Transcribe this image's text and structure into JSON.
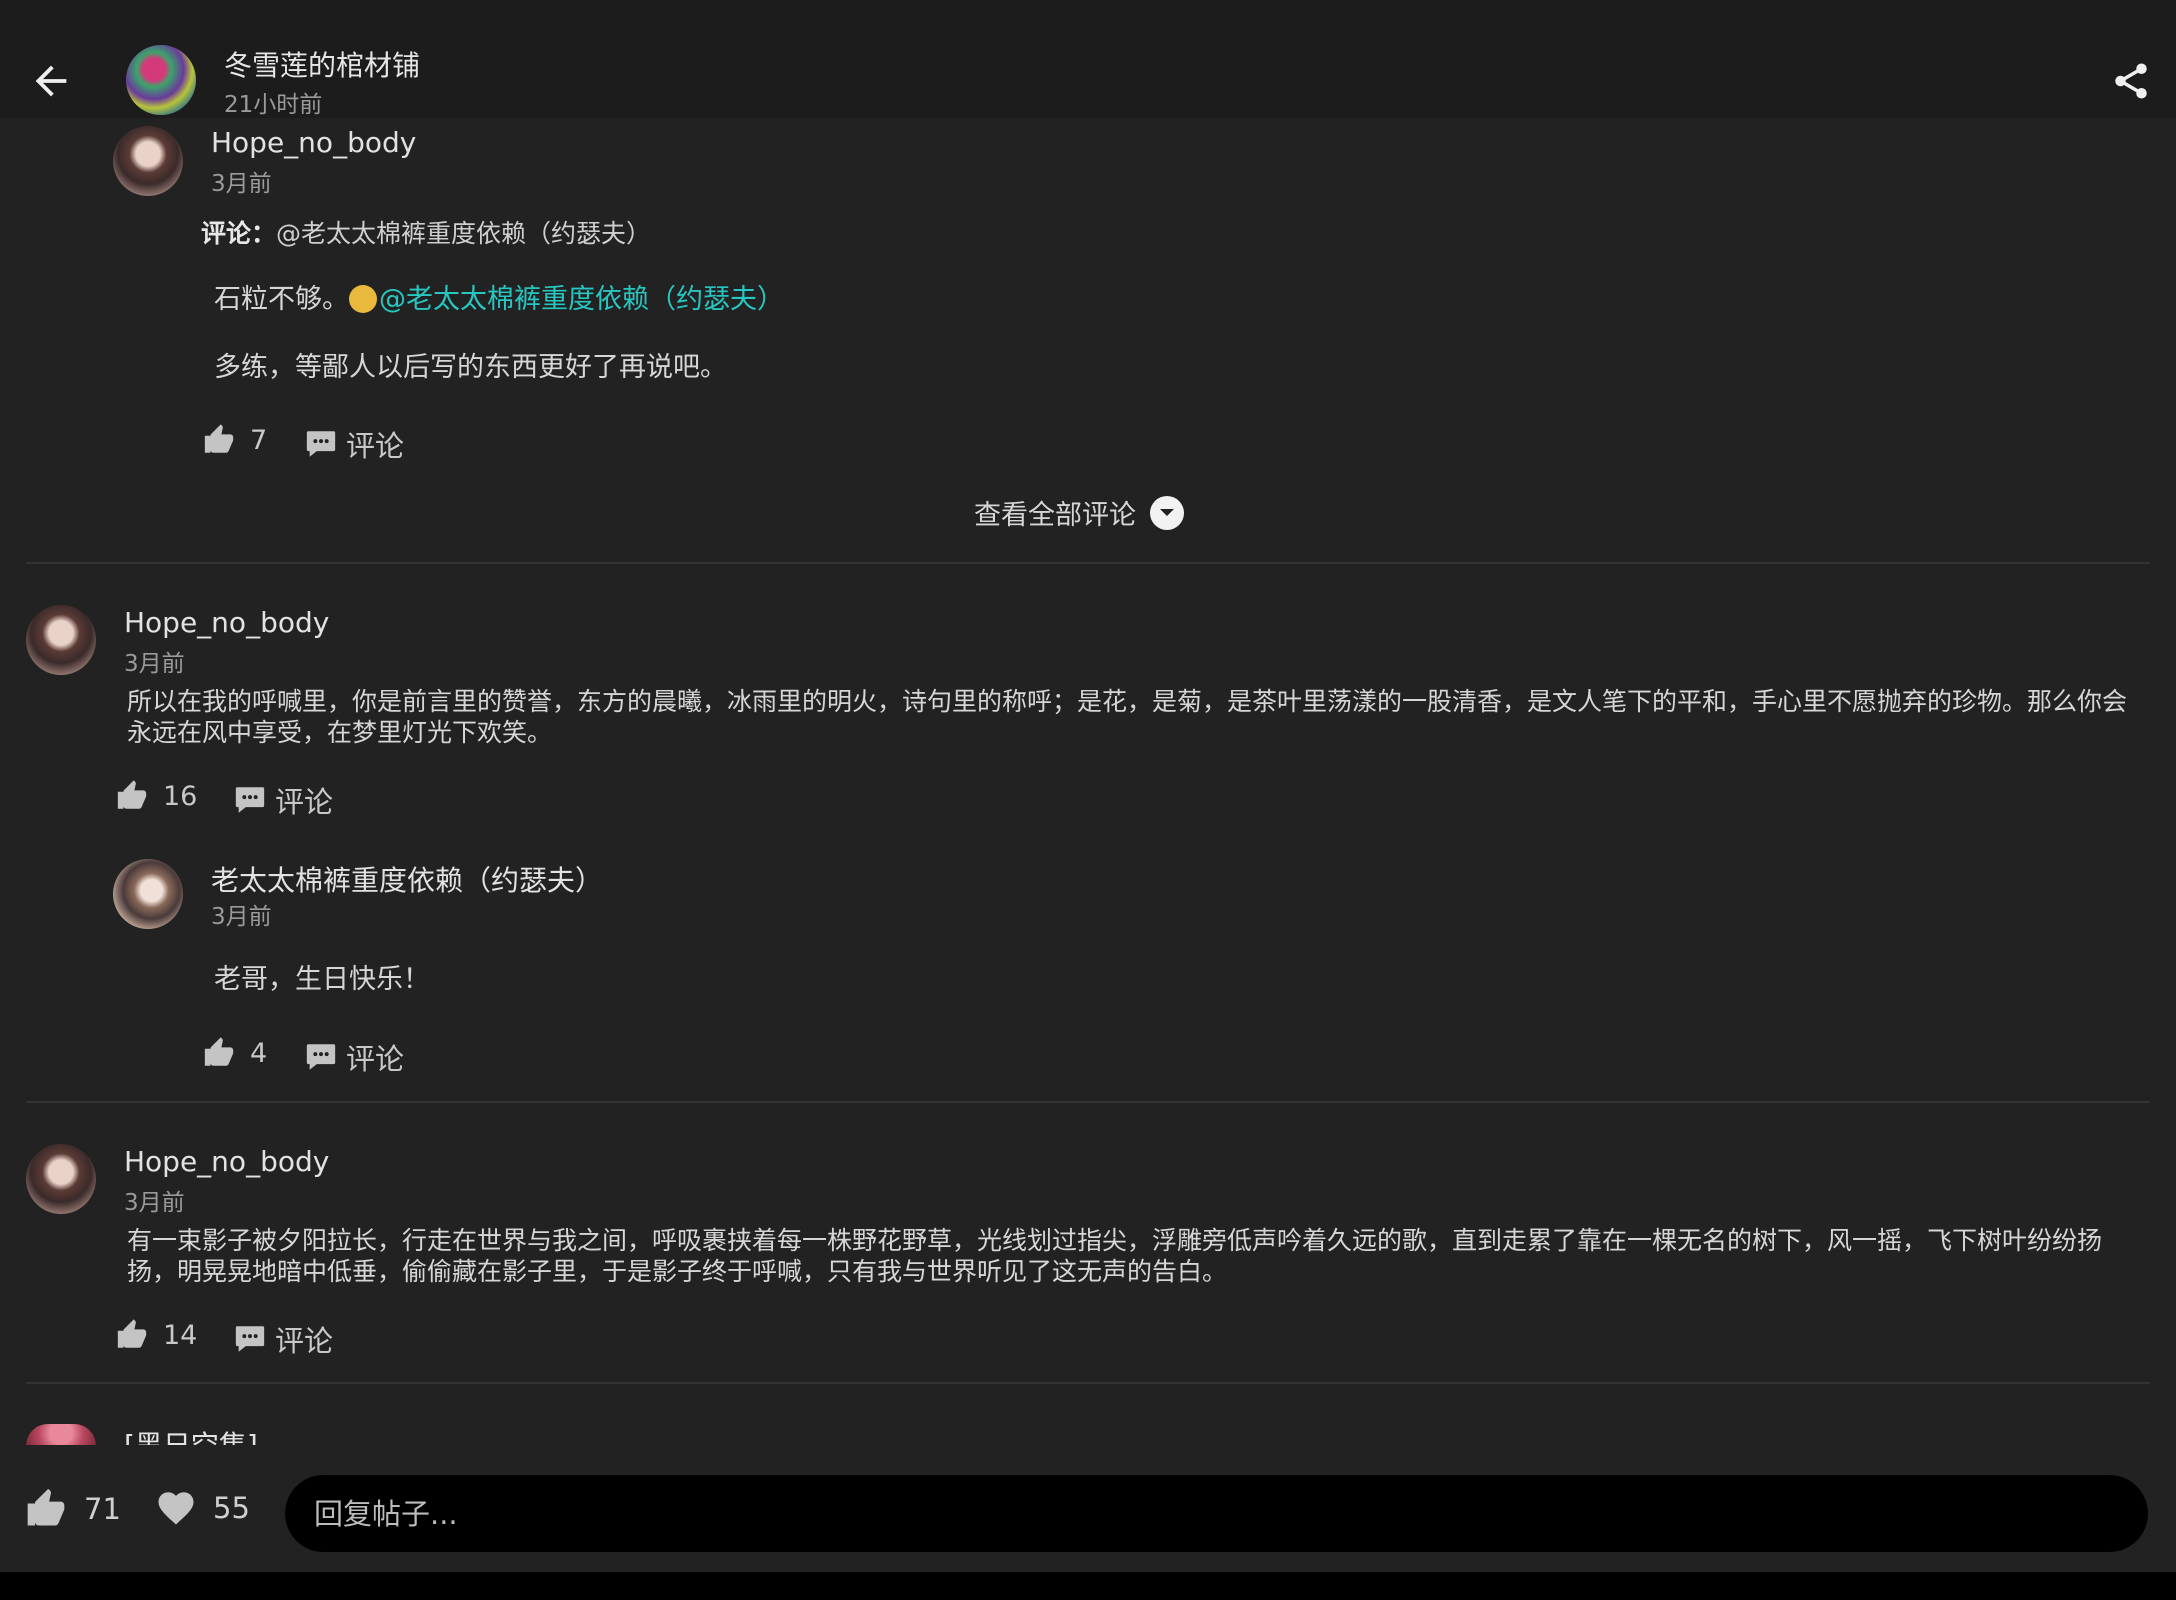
{
  "header": {
    "title": "冬雪莲的棺材铺",
    "time": "21小时前",
    "back_icon": "arrow-left-icon",
    "share_icon": "share-icon"
  },
  "reply_block": {
    "user": "Hope_no_body",
    "time": "3月前",
    "label_prefix": "评论：",
    "label_target": "@老太太棉裤重度依赖（约瑟夫）",
    "line1_text": "石粒不够。",
    "line1_mention": "@老太太棉裤重度依赖（约瑟夫）",
    "line2_text": "多练，等鄙人以后写的东西更好了再说吧。",
    "likes": "7",
    "comment_label": "评论"
  },
  "view_all": {
    "label": "查看全部评论"
  },
  "comments": [
    {
      "user": "Hope_no_body",
      "time": "3月前",
      "text": "所以在我的呼喊里，你是前言里的赞誉，东方的晨曦，冰雨里的明火，诗句里的称呼；是花，是菊，是茶叶里荡漾的一股清香，是文人笔下的平和，手心里不愿抛弃的珍物。那么你会永远在风中享受，在梦里灯光下欢笑。",
      "likes": "16",
      "comment_label": "评论",
      "reply": {
        "user": "老太太棉裤重度依赖（约瑟夫）",
        "time": "3月前",
        "text": "老哥，生日快乐！",
        "likes": "4",
        "comment_label": "评论"
      }
    },
    {
      "user": "Hope_no_body",
      "time": "3月前",
      "text": "有一束影子被夕阳拉长，行走在世界与我之间，呼吸裹挟着每一株野花野草，光线划过指尖，浮雕旁低声吟着久远的歌，直到走累了靠在一棵无名的树下，风一摇，飞下树叶纷纷扬扬，明晃晃地暗中低垂，偷偷藏在影子里，于是影子终于呼喊，只有我与世界听见了这无声的告白。",
      "likes": "14",
      "comment_label": "评论"
    }
  ],
  "partial_comment": {
    "user": "[黑日空集]"
  },
  "bottom_bar": {
    "likes": "71",
    "favorites": "55",
    "reply_placeholder": "回复帖子..."
  },
  "colors": {
    "background": "#222222",
    "header": "#1c1c1c",
    "mention": "#27c6c0",
    "input": "#000000"
  }
}
